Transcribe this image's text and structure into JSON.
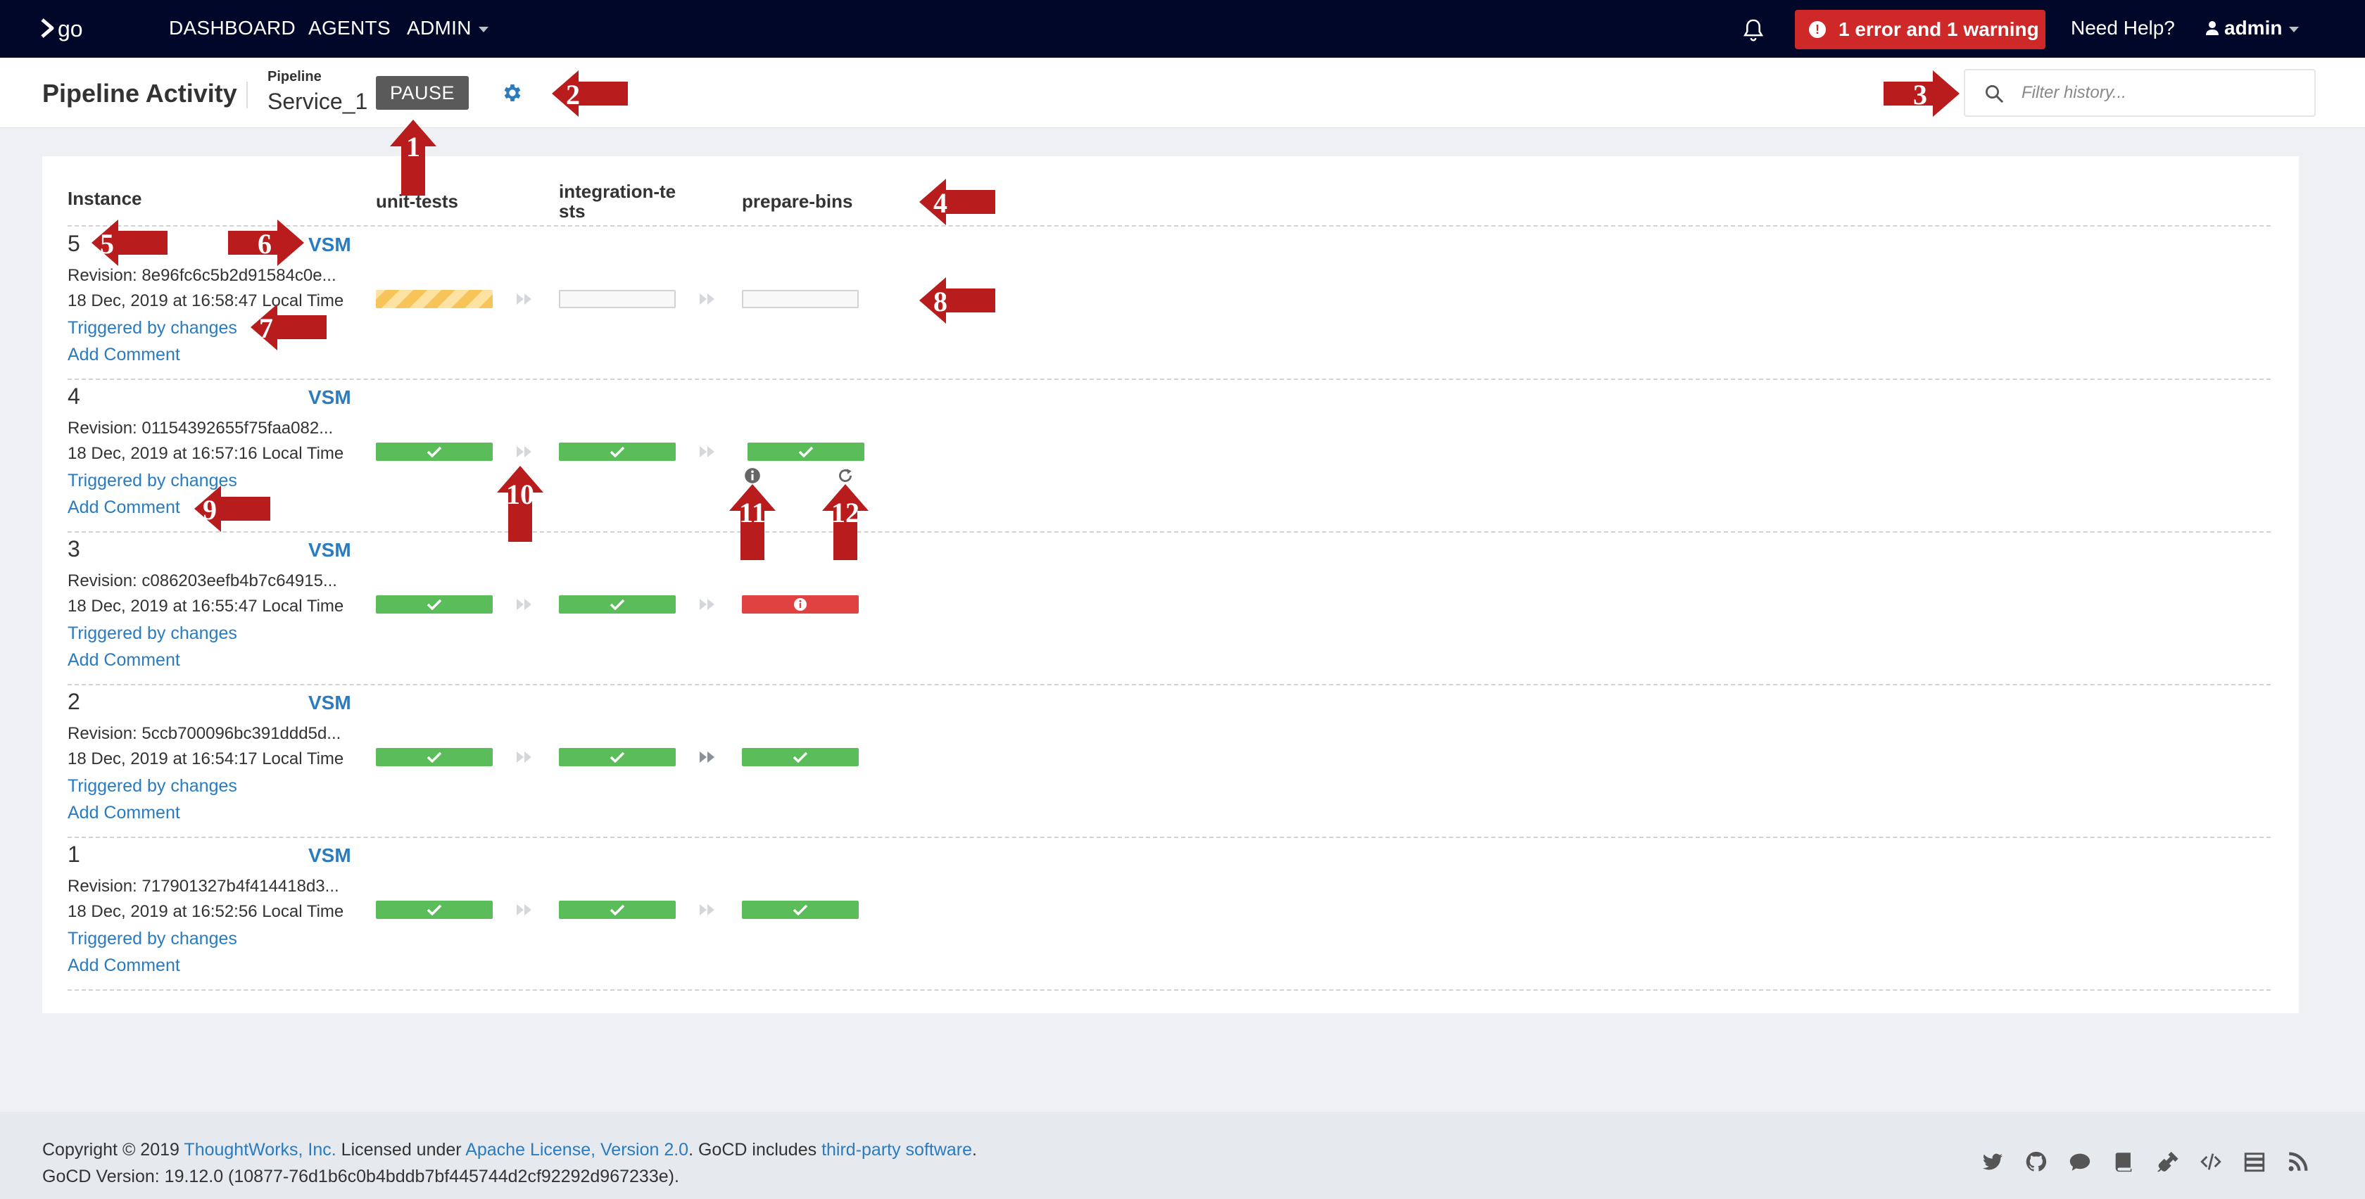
{
  "header": {
    "logo_text": "go",
    "nav": [
      "DASHBOARD",
      "AGENTS",
      "ADMIN"
    ],
    "errors_label": "1 error and 1 warning",
    "help_label": "Need Help?",
    "user_label": "admin"
  },
  "subheader": {
    "title": "Pipeline Activity",
    "pipeline_label": "Pipeline",
    "pipeline_name": "Service_1",
    "pause_label": "PAUSE",
    "filter_placeholder": "Filter history..."
  },
  "columns": {
    "instance": "Instance",
    "stages": [
      "unit-tests",
      "integration-te\nsts",
      "prepare-bins"
    ]
  },
  "rows": [
    {
      "counter": "5",
      "vsm": "VSM",
      "revision": "Revision: 8e96fc6c5b2d91584c0e...",
      "time": "18 Dec, 2019 at 16:58:47 Local Time",
      "trigger": "Triggered by changes",
      "comment": "Add Comment",
      "stages": [
        "building",
        "unknown",
        "unknown"
      ]
    },
    {
      "counter": "4",
      "vsm": "VSM",
      "revision": "Revision: 01154392655f75faa082...",
      "time": "18 Dec, 2019 at 16:57:16 Local Time",
      "trigger": "Triggered by changes",
      "comment": "Add Comment",
      "stages": [
        "passed",
        "passed",
        "passed"
      ]
    },
    {
      "counter": "3",
      "vsm": "VSM",
      "revision": "Revision: c086203eefb4b7c64915...",
      "time": "18 Dec, 2019 at 16:55:47 Local Time",
      "trigger": "Triggered by changes",
      "comment": "Add Comment",
      "stages": [
        "passed",
        "passed",
        "failed"
      ]
    },
    {
      "counter": "2",
      "vsm": "VSM",
      "revision": "Revision: 5ccb700096bc391ddd5d...",
      "time": "18 Dec, 2019 at 16:54:17 Local Time",
      "trigger": "Triggered by changes",
      "comment": "Add Comment",
      "stages": [
        "passed",
        "passed",
        "passed"
      ]
    },
    {
      "counter": "1",
      "vsm": "VSM",
      "revision": "Revision: 717901327b4f414418d3...",
      "time": "18 Dec, 2019 at 16:52:56 Local Time",
      "trigger": "Triggered by changes",
      "comment": "Add Comment",
      "stages": [
        "passed",
        "passed",
        "passed"
      ]
    }
  ],
  "annotations": [
    "1",
    "2",
    "3",
    "4",
    "5",
    "6",
    "7",
    "8",
    "9",
    "10",
    "11",
    "12"
  ],
  "footer": {
    "copyright": "Copyright © 2019 ",
    "company": "ThoughtWorks, Inc.",
    "licensed": " Licensed under ",
    "license": "Apache License, Version 2.0",
    "includes": ". GoCD includes ",
    "third_party": "third-party software",
    "period": ".",
    "version": "GoCD Version: 19.12.0 (10877-76d1b6c0b4bddb7bf445744d2cf92292d967233e)."
  },
  "colors": {
    "topbar": "#000728",
    "link": "#2a7bbf",
    "passed": "#5bbc5a",
    "failed": "#e04242",
    "building": "#f7c45a",
    "annotation": "#b81c1c"
  }
}
